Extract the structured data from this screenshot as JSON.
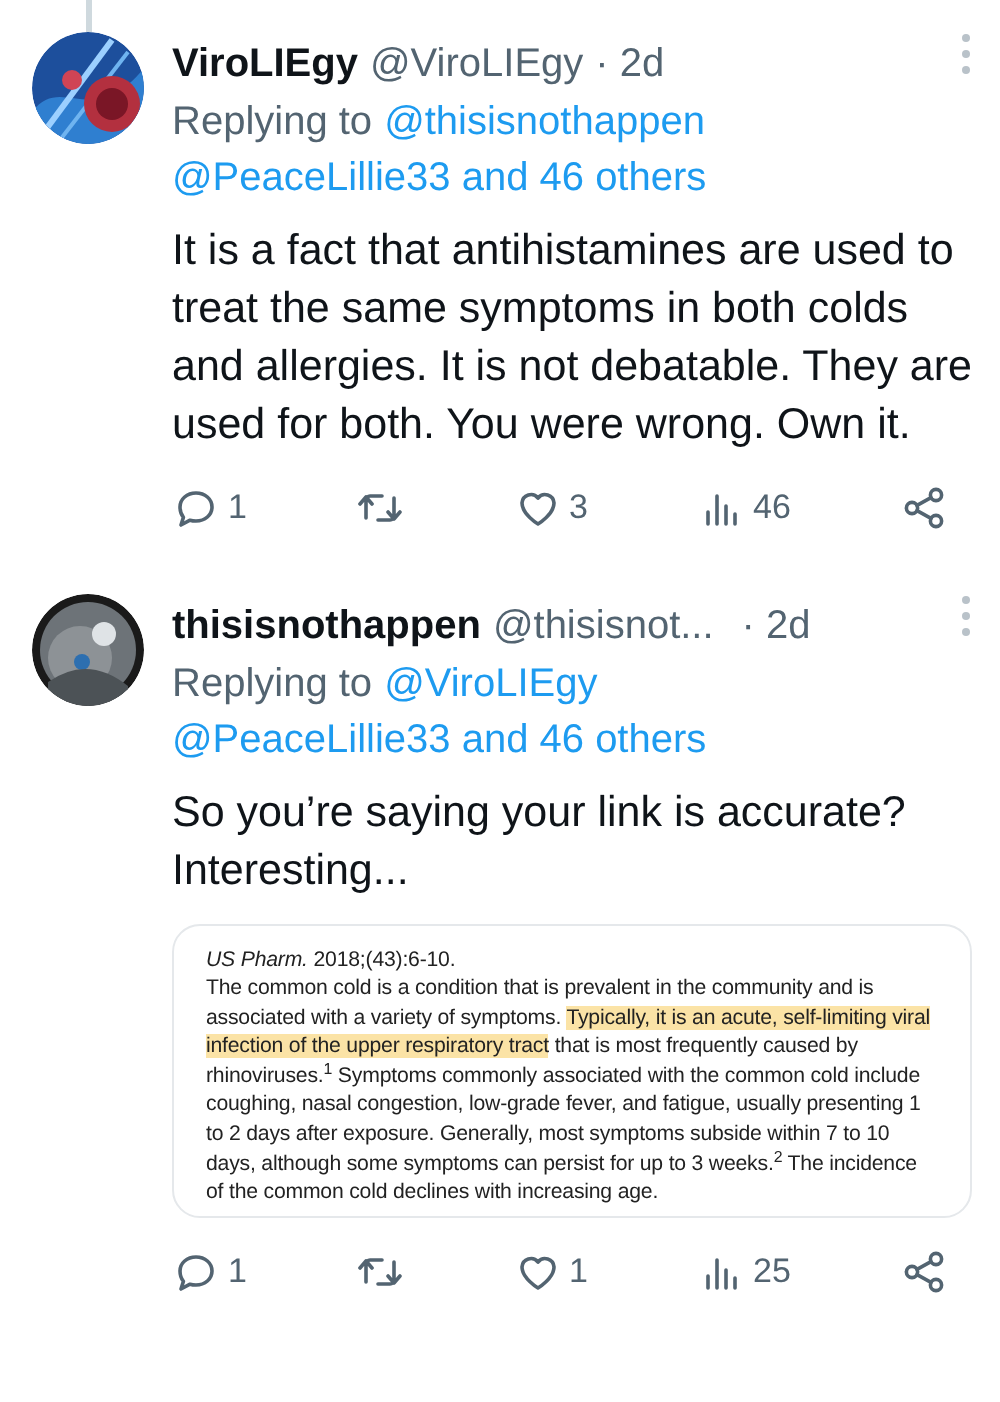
{
  "tweets": [
    {
      "display_name": "ViroLIEgy",
      "handle": "@ViroLIEgy",
      "time": "· 2d",
      "replying_label": "Replying to",
      "reply_targets": [
        "@thisisnothappen",
        "@PeaceLillie33 and 46 others"
      ],
      "text": "It is a fact that antihistamines are used to treat the same symptoms in both colds and allergies. It is not debatable. They are used for both. You were wrong. Own it.",
      "avatar": {
        "kind": "picture"
      },
      "actions": {
        "replies": "1",
        "likes": "3",
        "views": "46"
      }
    },
    {
      "display_name": "thisisnothappen",
      "handle": "@thisisnot...",
      "time": "· 2d",
      "replying_label": "Replying to",
      "reply_targets": [
        "@ViroLIEgy",
        "@PeaceLillie33 and 46 others"
      ],
      "text": "So you’re saying your link is accurate? Interesting...",
      "avatar": {
        "kind": "picture"
      },
      "attachment": {
        "citation": "*US Pharm.* 2018;(43):6-10.",
        "segments": [
          {
            "text": "The common cold is a condition that is prevalent in the community and is associated with a variety of symptoms. ",
            "highlighted": false
          },
          {
            "text": "Typically, it is an acute, self-limiting viral infection of the upper respiratory tract",
            "highlighted": true
          },
          {
            "text": " that is most frequently caused by rhinoviruses.$^{1}$ Symptoms commonly associated with the common cold include coughing, nasal congestion, low-grade fever, and fatigue, usually presenting 1 to 2 days after exposure. Generally, most symptoms subside within 7 to 10 days, although some symptoms can persist for up to 3 weeks.$^{2}$ The incidence of the common cold declines with increasing age.",
            "highlighted": false
          }
        ]
      },
      "actions": {
        "replies": "1",
        "likes": "1",
        "views": "25"
      }
    }
  ]
}
